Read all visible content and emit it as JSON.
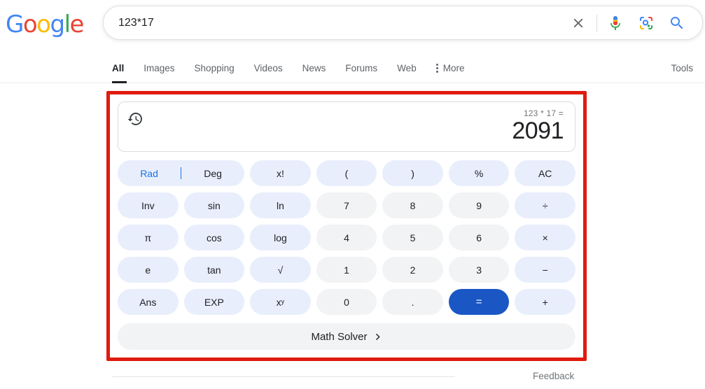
{
  "brand": {
    "name": "Google",
    "letters": [
      {
        "ch": "G",
        "color": "#4285f4"
      },
      {
        "ch": "o",
        "color": "#ea4335"
      },
      {
        "ch": "o",
        "color": "#fbbc05"
      },
      {
        "ch": "g",
        "color": "#4285f4"
      },
      {
        "ch": "l",
        "color": "#34a853"
      },
      {
        "ch": "e",
        "color": "#ea4335"
      }
    ]
  },
  "search": {
    "query": "123*17",
    "placeholder": "Search",
    "clear_icon": "close-icon",
    "voice_icon": "microphone-icon",
    "lens_icon": "google-lens-icon",
    "submit_icon": "search-icon"
  },
  "nav": {
    "tabs": [
      {
        "label": "All",
        "active": true
      },
      {
        "label": "Images",
        "active": false
      },
      {
        "label": "Shopping",
        "active": false
      },
      {
        "label": "Videos",
        "active": false
      },
      {
        "label": "News",
        "active": false
      },
      {
        "label": "Forums",
        "active": false
      },
      {
        "label": "Web",
        "active": false
      }
    ],
    "more_label": "More",
    "tools_label": "Tools"
  },
  "calculator": {
    "history_icon": "history-icon",
    "expression": "123 * 17 =",
    "result": "2091",
    "mode": {
      "rad_label": "Rad",
      "deg_label": "Deg",
      "active": "Rad"
    },
    "keys": [
      [
        {
          "label": "x!",
          "type": "fn"
        },
        {
          "label": "(",
          "type": "fn"
        },
        {
          "label": ")",
          "type": "fn"
        },
        {
          "label": "%",
          "type": "fn"
        },
        {
          "label": "AC",
          "type": "fn"
        }
      ],
      [
        {
          "label": "Inv",
          "type": "fn"
        },
        {
          "label": "sin",
          "type": "fn"
        },
        {
          "label": "ln",
          "type": "fn"
        },
        {
          "label": "7",
          "type": "num"
        },
        {
          "label": "8",
          "type": "num"
        },
        {
          "label": "9",
          "type": "num"
        },
        {
          "label": "÷",
          "type": "fn"
        }
      ],
      [
        {
          "label": "π",
          "type": "fn"
        },
        {
          "label": "cos",
          "type": "fn"
        },
        {
          "label": "log",
          "type": "fn"
        },
        {
          "label": "4",
          "type": "num"
        },
        {
          "label": "5",
          "type": "num"
        },
        {
          "label": "6",
          "type": "num"
        },
        {
          "label": "×",
          "type": "fn"
        }
      ],
      [
        {
          "label": "e",
          "type": "fn"
        },
        {
          "label": "tan",
          "type": "fn"
        },
        {
          "label": "√",
          "type": "fn"
        },
        {
          "label": "1",
          "type": "num"
        },
        {
          "label": "2",
          "type": "num"
        },
        {
          "label": "3",
          "type": "num"
        },
        {
          "label": "−",
          "type": "fn"
        }
      ],
      [
        {
          "label": "Ans",
          "type": "fn"
        },
        {
          "label": "EXP",
          "type": "fn"
        },
        {
          "label": "x^y",
          "type": "fn",
          "base": "x",
          "sup": "y"
        },
        {
          "label": "0",
          "type": "num"
        },
        {
          "label": ".",
          "type": "num"
        },
        {
          "label": "=",
          "type": "eq"
        },
        {
          "label": "+",
          "type": "fn"
        }
      ]
    ],
    "math_solver_label": "Math Solver"
  },
  "footer": {
    "feedback_label": "Feedback"
  },
  "colors": {
    "accent_blue": "#1a73e8",
    "equals_blue": "#1a56c4",
    "fn_key_bg": "#e8eefc",
    "num_key_bg": "#f1f3f4",
    "annotation_red": "#e01b0e"
  }
}
